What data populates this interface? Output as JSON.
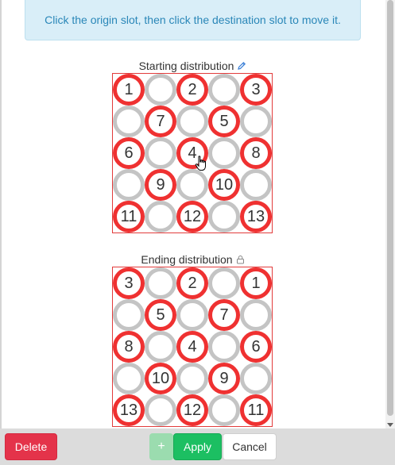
{
  "info": {
    "text": "Click the origin slot, then click the destination slot to move it."
  },
  "starting": {
    "caption": "Starting distribution",
    "icon": "pencil-icon",
    "slots": [
      "1",
      "",
      "2",
      "",
      "3",
      "",
      "7",
      "",
      "5",
      "",
      "6",
      "",
      "4",
      "",
      "8",
      "",
      "9",
      "",
      "10",
      "",
      "11",
      "",
      "12",
      "",
      "13"
    ]
  },
  "ending": {
    "caption": "Ending distribution",
    "icon": "lock-icon",
    "slots": [
      "3",
      "",
      "2",
      "",
      "1",
      "",
      "5",
      "",
      "7",
      "",
      "8",
      "",
      "4",
      "",
      "6",
      "",
      "10",
      "",
      "9",
      "",
      "13",
      "",
      "12",
      "",
      "11"
    ]
  },
  "footer": {
    "delete_label": "Delete",
    "ghost_label": "+",
    "apply_label": "Apply",
    "cancel_label": "Cancel"
  },
  "colors": {
    "filled_ring": "#ef3131",
    "empty_ring": "#c4c4c4",
    "board_border": "#e23c3c",
    "info_bg": "#d9eef8",
    "delete": "#e4334a",
    "apply": "#1cbf62"
  }
}
